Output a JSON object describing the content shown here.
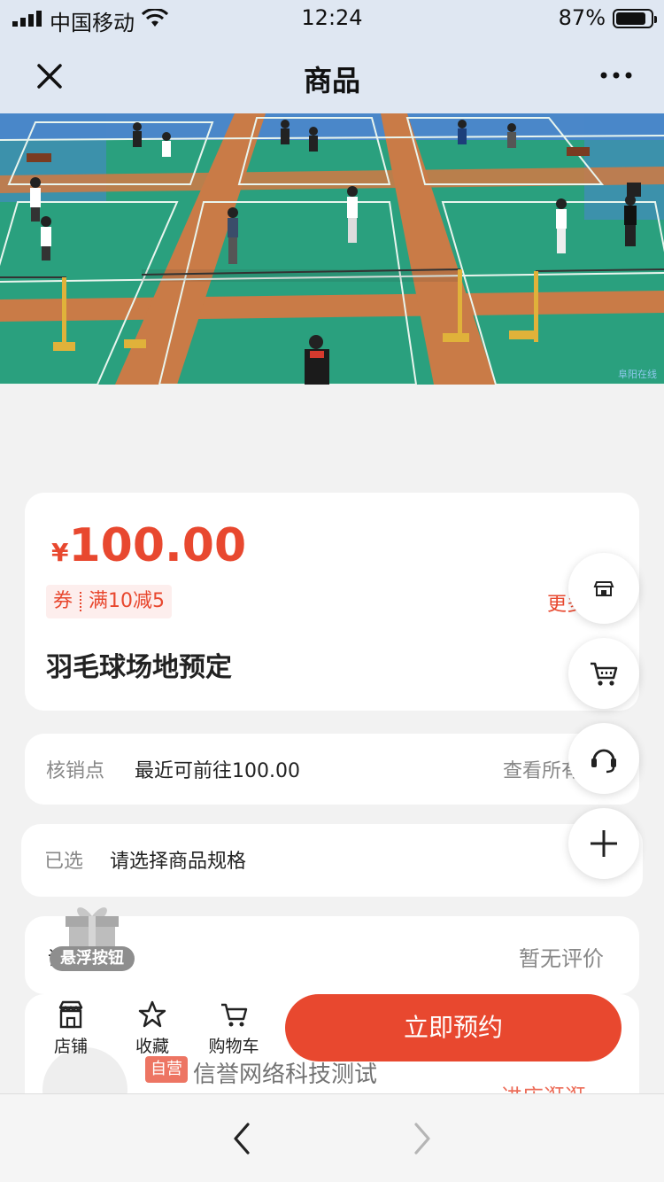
{
  "status_bar": {
    "carrier": "中国移动",
    "time": "12:24",
    "battery_percent": "87%",
    "battery_level": 0.87
  },
  "header": {
    "title": "商品",
    "close_icon": "close-icon",
    "more_icon": "more-horizontal-icon"
  },
  "product": {
    "price_symbol": "¥",
    "price": "100.00",
    "coupon_label": "券",
    "coupon_text": "满10减5",
    "more_label": "更多",
    "title": "羽毛球场地预定"
  },
  "verification": {
    "label": "核销点",
    "value": "最近可前往100.00",
    "link": "查看所有"
  },
  "selection": {
    "label": "已选",
    "value": "请选择商品规格"
  },
  "reviews": {
    "label": "评价",
    "value": "暂无评价"
  },
  "floating_badge": {
    "label": "悬浮按钮"
  },
  "store": {
    "self_tag": "自营",
    "name": "信誉网络科技测试",
    "enter_label": "进店逛逛"
  },
  "bottom_bar": {
    "store_label": "店铺",
    "favorite_label": "收藏",
    "cart_label": "购物车",
    "book_label": "立即预约"
  },
  "banner": {
    "watermark": "阜阳在线"
  },
  "colors": {
    "accent": "#e8482f",
    "header_bg": "#dfe7f2",
    "court_green": "#2aa07e"
  }
}
